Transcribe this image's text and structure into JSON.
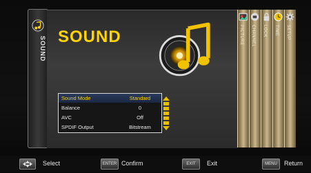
{
  "menu": {
    "title": "SOUND",
    "side_tab_label": "SOUND",
    "items": [
      {
        "label": "Sound Mode",
        "value": "Standard",
        "selected": true
      },
      {
        "label": "Balance",
        "value": "0",
        "selected": false
      },
      {
        "label": "AVC",
        "value": "Off",
        "selected": false
      },
      {
        "label": "SPDIF Output",
        "value": "Bitstream",
        "selected": false
      }
    ]
  },
  "right_tabs": [
    {
      "label": "PICTURE",
      "icon": "picture-icon"
    },
    {
      "label": "CHANNEL",
      "icon": "channel-icon"
    },
    {
      "label": "LOCK",
      "icon": "lock-icon"
    },
    {
      "label": "TIME",
      "icon": "clock-icon"
    },
    {
      "label": "SETUP",
      "icon": "gear-icon"
    }
  ],
  "bottom_bar": {
    "select": {
      "key": "",
      "label": "Select"
    },
    "confirm": {
      "key": "ENTER",
      "label": "Confirm"
    },
    "exit": {
      "key": "EXIT",
      "label": "Exit"
    },
    "return": {
      "key": "MENU",
      "label": "Return"
    }
  },
  "colors": {
    "accent": "#ffd400",
    "selection": "#1b2844"
  }
}
